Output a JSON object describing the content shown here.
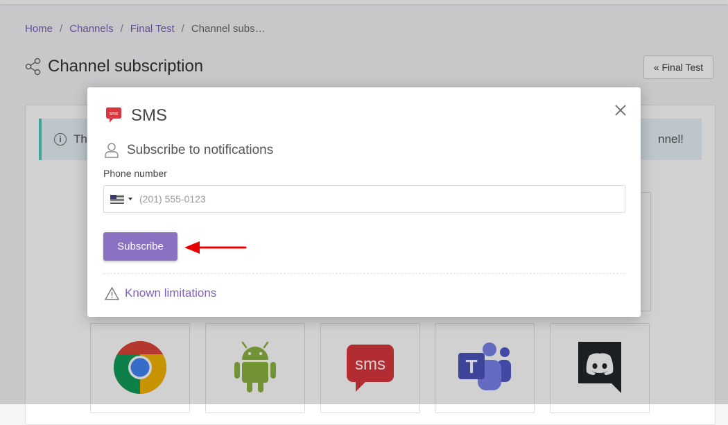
{
  "breadcrumb": {
    "items": [
      "Home",
      "Channels",
      "Final Test"
    ],
    "current": "Channel subs…",
    "separator": "/"
  },
  "page": {
    "title": "Channel subscription",
    "back_label": "« Final Test"
  },
  "alert": {
    "text_left": "Thi",
    "text_right": "nnel!"
  },
  "tiles": [
    {
      "icon": "chrome-icon"
    },
    {
      "icon": "android-icon"
    },
    {
      "icon": "sms-icon"
    },
    {
      "icon": "teams-icon"
    },
    {
      "icon": "discord-icon"
    }
  ],
  "modal": {
    "title": "SMS",
    "section_heading": "Subscribe to notifications",
    "phone_label": "Phone number",
    "phone_value": "",
    "phone_placeholder": "(201) 555-0123",
    "country": "US",
    "subscribe_label": "Subscribe",
    "limitations_label": "Known limitations"
  },
  "colors": {
    "accent": "#8c71c2",
    "link": "#7a5fb3",
    "alert_border": "#4fc9be",
    "arrow": "#e60000",
    "sms_red": "#d9373d"
  }
}
